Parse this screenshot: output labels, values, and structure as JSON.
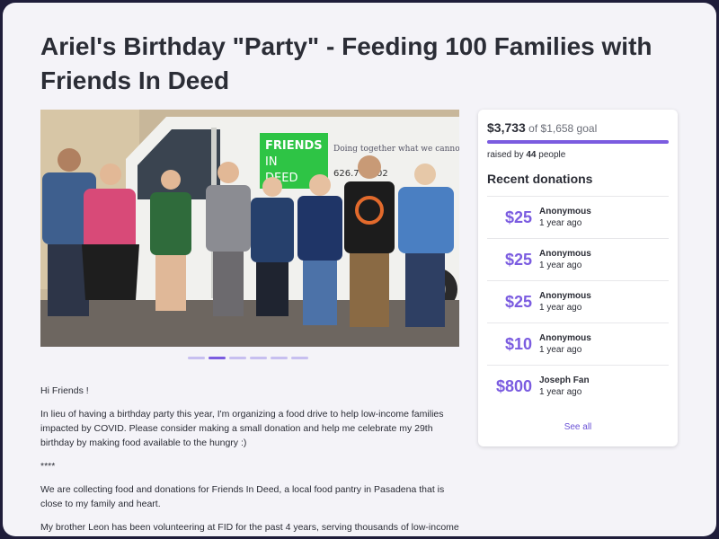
{
  "campaign": {
    "title": "Ariel's Birthday \"Party\" - Feeding 100 Families with Friends In Deed"
  },
  "photo": {
    "van_logo": [
      "FRIENDS",
      "IN",
      "DEED"
    ],
    "van_tagline": "Doing together what we cannot",
    "van_phone": "626.7",
    "van_phone_end": "02",
    "carousel_count": 6,
    "carousel_active": 1
  },
  "story": {
    "paragraphs": [
      "Hi Friends !",
      "In lieu of having a birthday party this year, I'm organizing a food drive to help low-income families impacted by COVID. Please consider making a small donation and help me celebrate my 29th birthday by making food available to the hungry :)",
      "****",
      "We are collecting food and donations for Friends In Deed, a local food pantry in Pasadena that is close to my family and heart.",
      "My brother Leon has been volunteering at FID for the past 4 years, serving thousands of low-income and"
    ]
  },
  "fundraiser": {
    "raised": "$3,733",
    "goal_text": "of $1,658 goal",
    "progress": 1.0,
    "people_prefix": "raised by",
    "people_count": "44",
    "people_suffix": "people",
    "recent_title": "Recent donations",
    "donations": [
      {
        "amount": "$25",
        "name": "Anonymous",
        "time": "1 year ago"
      },
      {
        "amount": "$25",
        "name": "Anonymous",
        "time": "1 year ago"
      },
      {
        "amount": "$25",
        "name": "Anonymous",
        "time": "1 year ago"
      },
      {
        "amount": "$10",
        "name": "Anonymous",
        "time": "1 year ago"
      },
      {
        "amount": "$800",
        "name": "Joseph Fan",
        "time": "1 year ago"
      }
    ],
    "see_all": "See all"
  },
  "colors": {
    "accent": "#7b5ce0",
    "van_logo_green": "#2ec445",
    "text": "#2b2d36",
    "page_bg": "#f4f3f8"
  }
}
